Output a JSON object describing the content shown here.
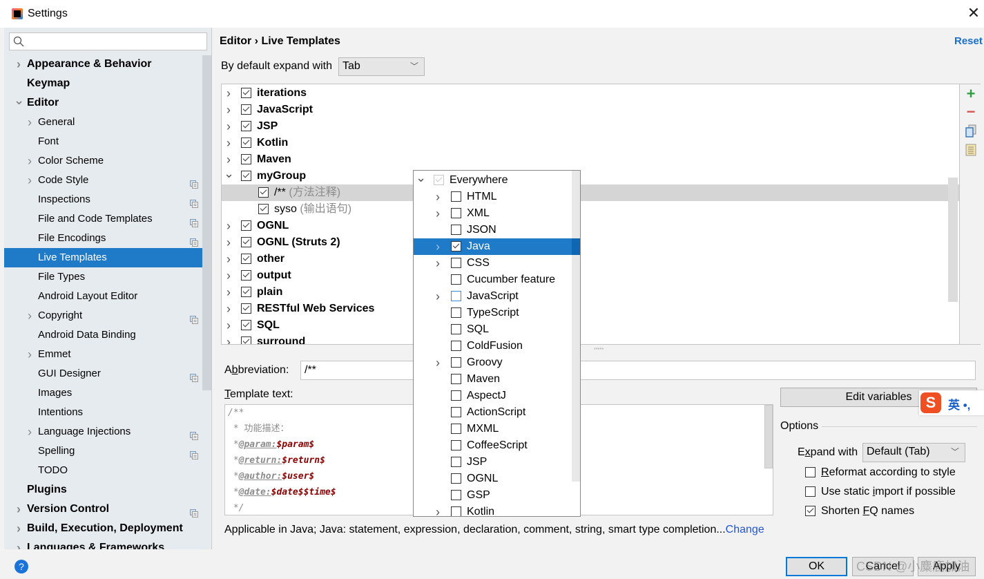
{
  "window": {
    "title": "Settings",
    "close_label": "✕"
  },
  "search": {
    "placeholder": ""
  },
  "sidebar": {
    "items": [
      {
        "label": "Appearance & Behavior",
        "level": 0,
        "bold": true,
        "expandable": "collapsed",
        "project_icon": false
      },
      {
        "label": "Keymap",
        "level": 0,
        "bold": true,
        "expandable": "none",
        "project_icon": false
      },
      {
        "label": "Editor",
        "level": 0,
        "bold": true,
        "expandable": "expanded",
        "project_icon": false
      },
      {
        "label": "General",
        "level": 1,
        "bold": false,
        "expandable": "collapsed",
        "project_icon": false
      },
      {
        "label": "Font",
        "level": 1,
        "bold": false,
        "expandable": "none",
        "project_icon": false
      },
      {
        "label": "Color Scheme",
        "level": 1,
        "bold": false,
        "expandable": "collapsed",
        "project_icon": false
      },
      {
        "label": "Code Style",
        "level": 1,
        "bold": false,
        "expandable": "collapsed",
        "project_icon": true
      },
      {
        "label": "Inspections",
        "level": 1,
        "bold": false,
        "expandable": "none",
        "project_icon": true
      },
      {
        "label": "File and Code Templates",
        "level": 1,
        "bold": false,
        "expandable": "none",
        "project_icon": true
      },
      {
        "label": "File Encodings",
        "level": 1,
        "bold": false,
        "expandable": "none",
        "project_icon": true
      },
      {
        "label": "Live Templates",
        "level": 1,
        "bold": false,
        "expandable": "none",
        "project_icon": false,
        "selected": true
      },
      {
        "label": "File Types",
        "level": 1,
        "bold": false,
        "expandable": "none",
        "project_icon": false
      },
      {
        "label": "Android Layout Editor",
        "level": 1,
        "bold": false,
        "expandable": "none",
        "project_icon": false
      },
      {
        "label": "Copyright",
        "level": 1,
        "bold": false,
        "expandable": "collapsed",
        "project_icon": true
      },
      {
        "label": "Android Data Binding",
        "level": 1,
        "bold": false,
        "expandable": "none",
        "project_icon": false
      },
      {
        "label": "Emmet",
        "level": 1,
        "bold": false,
        "expandable": "collapsed",
        "project_icon": false
      },
      {
        "label": "GUI Designer",
        "level": 1,
        "bold": false,
        "expandable": "none",
        "project_icon": true
      },
      {
        "label": "Images",
        "level": 1,
        "bold": false,
        "expandable": "none",
        "project_icon": false
      },
      {
        "label": "Intentions",
        "level": 1,
        "bold": false,
        "expandable": "none",
        "project_icon": false
      },
      {
        "label": "Language Injections",
        "level": 1,
        "bold": false,
        "expandable": "collapsed",
        "project_icon": true
      },
      {
        "label": "Spelling",
        "level": 1,
        "bold": false,
        "expandable": "none",
        "project_icon": true
      },
      {
        "label": "TODO",
        "level": 1,
        "bold": false,
        "expandable": "none",
        "project_icon": false
      },
      {
        "label": "Plugins",
        "level": 0,
        "bold": true,
        "expandable": "none",
        "project_icon": false
      },
      {
        "label": "Version Control",
        "level": 0,
        "bold": true,
        "expandable": "collapsed",
        "project_icon": true
      },
      {
        "label": "Build, Execution, Deployment",
        "level": 0,
        "bold": true,
        "expandable": "collapsed",
        "project_icon": false
      },
      {
        "label": "Languages & Frameworks",
        "level": 0,
        "bold": true,
        "expandable": "collapsed",
        "project_icon": false
      }
    ]
  },
  "header": {
    "breadcrumb_parent": "Editor",
    "breadcrumb_sep": "›",
    "breadcrumb_current": "Live Templates",
    "reset_label": "Reset"
  },
  "expand_default": {
    "label": "By default expand with",
    "value": "Tab"
  },
  "templates": [
    {
      "name": "iterations",
      "group": true,
      "checked": true,
      "expanded": false
    },
    {
      "name": "JavaScript",
      "group": true,
      "checked": true,
      "expanded": false
    },
    {
      "name": "JSP",
      "group": true,
      "checked": true,
      "expanded": false
    },
    {
      "name": "Kotlin",
      "group": true,
      "checked": true,
      "expanded": false
    },
    {
      "name": "Maven",
      "group": true,
      "checked": true,
      "expanded": false
    },
    {
      "name": "myGroup",
      "group": true,
      "checked": true,
      "expanded": true
    },
    {
      "name": "/**",
      "desc": "(方法注释)",
      "group": false,
      "checked": true,
      "selected": true
    },
    {
      "name": "syso",
      "desc": "(输出语句)",
      "group": false,
      "checked": true
    },
    {
      "name": "OGNL",
      "group": true,
      "checked": true,
      "expanded": false
    },
    {
      "name": "OGNL (Struts 2)",
      "group": true,
      "checked": true,
      "expanded": false
    },
    {
      "name": "other",
      "group": true,
      "checked": true,
      "expanded": false
    },
    {
      "name": "output",
      "group": true,
      "checked": true,
      "expanded": false
    },
    {
      "name": "plain",
      "group": true,
      "checked": true,
      "expanded": false
    },
    {
      "name": "RESTful Web Services",
      "group": true,
      "checked": true,
      "expanded": false
    },
    {
      "name": "SQL",
      "group": true,
      "checked": true,
      "expanded": false
    },
    {
      "name": "surround",
      "group": true,
      "checked": true,
      "expanded": false
    }
  ],
  "tools": {
    "add": "+",
    "remove": "−"
  },
  "abbreviation": {
    "label_pre": "A",
    "label_mnemonic": "b",
    "label_post": "breviation:",
    "value": "/**"
  },
  "template_text": {
    "label_mnemonic": "T",
    "label_post": "emplate text:",
    "lines": [
      {
        "parts": [
          {
            "t": "/**",
            "c": ""
          }
        ]
      },
      {
        "parts": [
          {
            "t": " * ",
            "c": ""
          },
          {
            "t": "功能描述：",
            "c": "plain"
          }
        ]
      },
      {
        "parts": [
          {
            "t": " *",
            "c": ""
          },
          {
            "t": "@param:",
            "c": "tag"
          },
          {
            "t": "$param$",
            "c": "var"
          }
        ]
      },
      {
        "parts": [
          {
            "t": " *",
            "c": ""
          },
          {
            "t": "@return:",
            "c": "tag"
          },
          {
            "t": "$return$",
            "c": "var"
          }
        ]
      },
      {
        "parts": [
          {
            "t": " *",
            "c": ""
          },
          {
            "t": "@author:",
            "c": "tag"
          },
          {
            "t": "$user$",
            "c": "var"
          }
        ]
      },
      {
        "parts": [
          {
            "t": " *",
            "c": ""
          },
          {
            "t": "@date:",
            "c": "tag"
          },
          {
            "t": "$date$$time$",
            "c": "var"
          }
        ]
      },
      {
        "parts": [
          {
            "t": " */",
            "c": ""
          }
        ]
      }
    ]
  },
  "edit_variables_label": "Edit variables",
  "options": {
    "title": "Options",
    "expand_with_pre": "E",
    "expand_with_mnemonic": "x",
    "expand_with_post": "pand with",
    "expand_with_value": "Default (Tab)",
    "checkboxes": [
      {
        "pre": "",
        "mn": "R",
        "post": "eformat according to style",
        "checked": false
      },
      {
        "pre": "Use static ",
        "mn": "i",
        "post": "mport if possible",
        "checked": false
      },
      {
        "pre": "Shorten ",
        "mn": "F",
        "post": "Q names",
        "checked": true
      }
    ]
  },
  "applicable": {
    "text": "Applicable in Java; Java: statement, expression, declaration, comment, string, smart type completion...",
    "link": "Change"
  },
  "buttons": {
    "ok": "OK",
    "cancel": "Cancel",
    "apply": "Apply"
  },
  "watermark": "CSDN @小麋鹿加油",
  "context_popup": {
    "items": [
      {
        "label": "Everywhere",
        "level": 0,
        "expandable": "expanded",
        "checked": true,
        "disabled": true
      },
      {
        "label": "HTML",
        "level": 1,
        "expandable": "collapsed",
        "checked": false
      },
      {
        "label": "XML",
        "level": 1,
        "expandable": "collapsed",
        "checked": false
      },
      {
        "label": "JSON",
        "level": 1,
        "expandable": "none",
        "checked": false
      },
      {
        "label": "Java",
        "level": 1,
        "expandable": "collapsed",
        "checked": true,
        "selected": true
      },
      {
        "label": "CSS",
        "level": 1,
        "expandable": "collapsed",
        "checked": false
      },
      {
        "label": "Cucumber feature",
        "level": 1,
        "expandable": "none",
        "checked": false
      },
      {
        "label": "JavaScript",
        "level": 1,
        "expandable": "collapsed",
        "checked": false,
        "focused": true
      },
      {
        "label": "TypeScript",
        "level": 1,
        "expandable": "none",
        "checked": false
      },
      {
        "label": "SQL",
        "level": 1,
        "expandable": "none",
        "checked": false
      },
      {
        "label": "ColdFusion",
        "level": 1,
        "expandable": "none",
        "checked": false
      },
      {
        "label": "Groovy",
        "level": 1,
        "expandable": "collapsed",
        "checked": false
      },
      {
        "label": "Maven",
        "level": 1,
        "expandable": "none",
        "checked": false
      },
      {
        "label": "AspectJ",
        "level": 1,
        "expandable": "none",
        "checked": false
      },
      {
        "label": "ActionScript",
        "level": 1,
        "expandable": "none",
        "checked": false
      },
      {
        "label": "MXML",
        "level": 1,
        "expandable": "none",
        "checked": false
      },
      {
        "label": "CoffeeScript",
        "level": 1,
        "expandable": "none",
        "checked": false
      },
      {
        "label": "JSP",
        "level": 1,
        "expandable": "none",
        "checked": false
      },
      {
        "label": "OGNL",
        "level": 1,
        "expandable": "none",
        "checked": false
      },
      {
        "label": "GSP",
        "level": 1,
        "expandable": "none",
        "checked": false
      },
      {
        "label": "Kotlin",
        "level": 1,
        "expandable": "collapsed",
        "checked": false
      }
    ]
  },
  "ime": {
    "logo": "S",
    "text": "英 •,"
  }
}
